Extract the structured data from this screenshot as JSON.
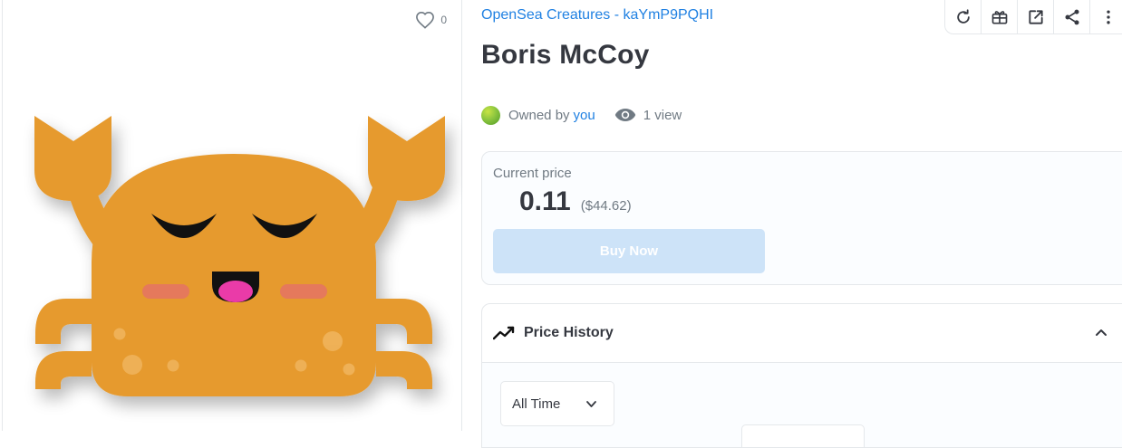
{
  "asset": {
    "collection_name": "OpenSea Creatures - kaYmP9PQHI",
    "title": "Boris McCoy",
    "favorites_count": "0"
  },
  "ownership": {
    "owned_by_prefix": "Owned by",
    "owner_name": "you",
    "views_label": "1 view"
  },
  "price": {
    "label": "Current price",
    "value": "0.11",
    "usd": "($44.62)",
    "buy_label": "Buy Now"
  },
  "price_history": {
    "title": "Price History",
    "period_selected": "All Time"
  },
  "toolbar": {
    "icons": [
      "refresh-icon",
      "gift-icon",
      "external-link-icon",
      "share-icon",
      "more-icon"
    ]
  },
  "colors": {
    "accent_blue": "#2081e2",
    "crab_orange": "#e69a2e",
    "buy_disabled": "#cde3f8",
    "text_dark": "#353840",
    "text_muted": "#707a83"
  }
}
